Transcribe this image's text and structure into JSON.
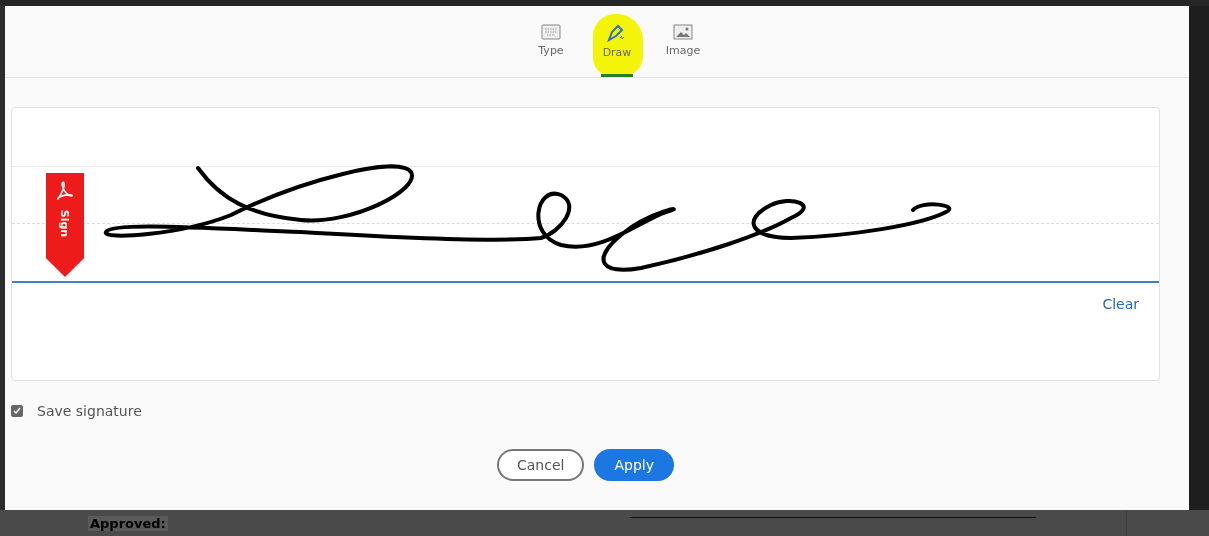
{
  "tabs": [
    {
      "label": "Type",
      "kind": "keyboard",
      "selected": false
    },
    {
      "label": "Draw",
      "kind": "pen",
      "selected": true
    },
    {
      "label": "Image",
      "kind": "image",
      "selected": false
    }
  ],
  "signature_pad": {
    "bookmark_label": "Sign",
    "clear": "Clear"
  },
  "save_signature": {
    "label": "Save signature",
    "checked": true
  },
  "buttons": [
    {
      "label": "Cancel",
      "kind": "secondary"
    },
    {
      "label": "Apply",
      "kind": "primary"
    }
  ],
  "background_document": {
    "label": "Approved:"
  }
}
